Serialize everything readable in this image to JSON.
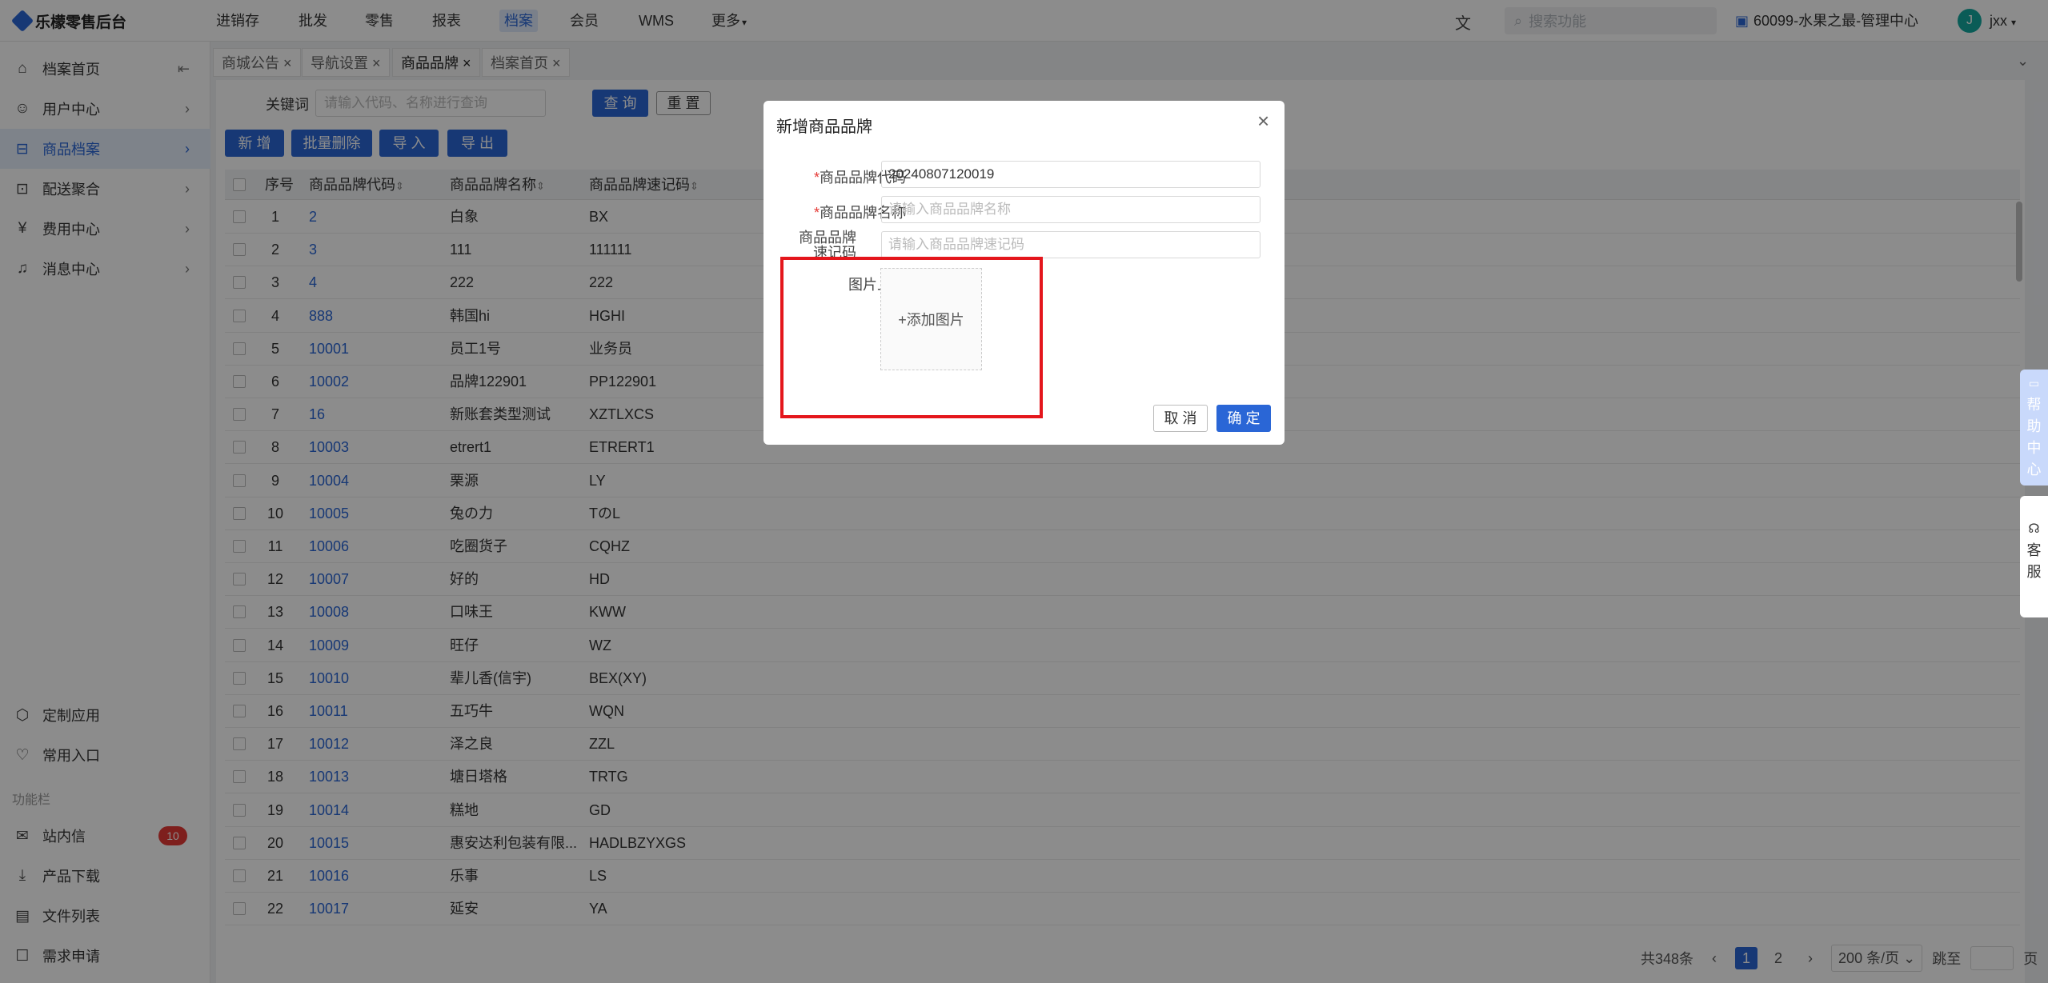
{
  "app": {
    "logo": "乐檬零售后台"
  },
  "topnav": [
    "进销存",
    "批发",
    "零售",
    "报表",
    "档案",
    "会员",
    "WMS",
    "更多"
  ],
  "topnav_active": "档案",
  "search": {
    "placeholder": "搜索功能"
  },
  "store": "60099-水果之最-管理中心",
  "user": {
    "avatar": "J",
    "name": "jxx"
  },
  "sidebar": {
    "items": [
      {
        "label": "档案首页",
        "icon": "home-icon"
      },
      {
        "label": "用户中心",
        "icon": "user-icon"
      },
      {
        "label": "商品档案",
        "icon": "product-icon"
      },
      {
        "label": "配送聚合",
        "icon": "delivery-icon"
      },
      {
        "label": "费用中心",
        "icon": "money-icon"
      },
      {
        "label": "消息中心",
        "icon": "bell-icon"
      }
    ],
    "bottom": [
      {
        "label": "定制应用",
        "icon": "cube-icon"
      },
      {
        "label": "常用入口",
        "icon": "heart-icon"
      }
    ],
    "func_label": "功能栏",
    "func": [
      {
        "label": "站内信",
        "icon": "mail-icon"
      },
      {
        "label": "产品下载",
        "icon": "download-icon"
      },
      {
        "label": "文件列表",
        "icon": "chart-icon"
      },
      {
        "label": "需求申请",
        "icon": "message-icon"
      }
    ],
    "badge": "10"
  },
  "tabs": [
    "商城公告",
    "导航设置",
    "商品品牌",
    "档案首页"
  ],
  "toolbar": {
    "keyword_label": "关键词",
    "keyword_placeholder": "请输入代码、名称进行查询",
    "query": "查 询",
    "reset": "重 置",
    "add": "新 增",
    "batch_delete": "批量删除",
    "import": "导 入",
    "export": "导 出"
  },
  "table": {
    "headers": [
      "序号",
      "商品品牌代码",
      "商品品牌名称",
      "商品品牌速记码"
    ],
    "rows": [
      [
        "1",
        "2",
        "白象",
        "BX"
      ],
      [
        "2",
        "3",
        "111",
        "111111"
      ],
      [
        "3",
        "4",
        "222",
        "222"
      ],
      [
        "4",
        "888",
        "韩国hi",
        "HGHI"
      ],
      [
        "5",
        "10001",
        "员工1号",
        "业务员"
      ],
      [
        "6",
        "10002",
        "品牌122901",
        "PP122901"
      ],
      [
        "7",
        "16",
        "新账套类型测试",
        "XZTLXCS"
      ],
      [
        "8",
        "10003",
        "etrert1",
        "ETRERT1"
      ],
      [
        "9",
        "10004",
        "栗源",
        "LY"
      ],
      [
        "10",
        "10005",
        "兔の力",
        "TのL"
      ],
      [
        "11",
        "10006",
        "吃圈货子",
        "CQHZ"
      ],
      [
        "12",
        "10007",
        "好的",
        "HD"
      ],
      [
        "13",
        "10008",
        "口味王",
        "KWW"
      ],
      [
        "14",
        "10009",
        "旺仔",
        "WZ"
      ],
      [
        "15",
        "10010",
        "辈儿香(信宇)",
        "BEX(XY)"
      ],
      [
        "16",
        "10011",
        "五巧牛",
        "WQN"
      ],
      [
        "17",
        "10012",
        "泽之良",
        "ZZL"
      ],
      [
        "18",
        "10013",
        "塘日塔格",
        "TRTG"
      ],
      [
        "19",
        "10014",
        "糕地",
        "GD"
      ],
      [
        "20",
        "10015",
        "惠安达利包装有限...",
        "HADLBZYXGS"
      ],
      [
        "21",
        "10016",
        "乐事",
        "LS"
      ],
      [
        "22",
        "10017",
        "延安",
        "YA"
      ]
    ]
  },
  "pagination": {
    "total": "共348条",
    "pages": [
      "1",
      "2"
    ],
    "current": "1",
    "page_size": "200 条/页",
    "jump_label": "跳至",
    "page_label": "页"
  },
  "modal": {
    "title": "新增商品品牌",
    "fields": [
      {
        "label": "商品品牌代码",
        "required": true,
        "value": "20240807120019",
        "placeholder": ""
      },
      {
        "label": "商品品牌名称",
        "required": true,
        "value": "",
        "placeholder": "请输入商品品牌名称"
      },
      {
        "label": "商品品牌速记码",
        "required": false,
        "value": "",
        "placeholder": "请输入商品品牌速记码"
      }
    ],
    "upload_label": "图片上传",
    "upload_button": "+添加图片",
    "cancel": "取 消",
    "ok": "确 定"
  },
  "float": {
    "help": [
      "帮",
      "助",
      "中",
      "心"
    ],
    "service": [
      "客",
      "服"
    ]
  },
  "colors": {
    "accent": "#2a66d6",
    "highlight": "#e4161c",
    "badge": "#e53935"
  }
}
